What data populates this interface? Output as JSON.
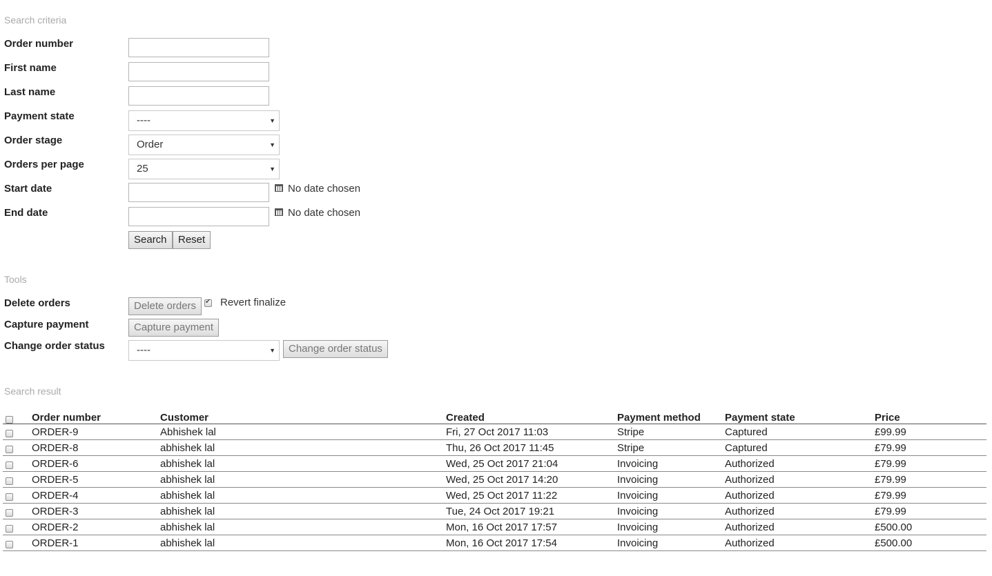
{
  "search": {
    "title": "Search criteria",
    "order_number_label": "Order number",
    "first_name_label": "First name",
    "last_name_label": "Last name",
    "payment_state_label": "Payment state",
    "payment_state_value": "----",
    "order_stage_label": "Order stage",
    "order_stage_value": "Order",
    "orders_per_page_label": "Orders per page",
    "orders_per_page_value": "25",
    "start_date_label": "Start date",
    "start_date_note": "No date chosen",
    "end_date_label": "End date",
    "end_date_note": "No date chosen",
    "search_button": "Search",
    "reset_button": "Reset",
    "dropdown_arrow": "▼"
  },
  "tools": {
    "title": "Tools",
    "delete_label": "Delete orders",
    "delete_button": "Delete orders",
    "revert_label": "Revert finalize",
    "revert_checked": true,
    "check_glyph": "✔",
    "capture_label": "Capture payment",
    "capture_button": "Capture payment",
    "status_label": "Change order status",
    "status_value": "----",
    "status_button": "Change order status"
  },
  "results": {
    "title": "Search result",
    "columns": [
      "Order number",
      "Customer",
      "Created",
      "Payment method",
      "Payment state",
      "Price"
    ],
    "rows": [
      {
        "order": "ORDER-9",
        "customer": "Abhishek lal",
        "created": "Fri, 27 Oct 2017 11:03",
        "method": "Stripe",
        "state": "Captured",
        "price": "£99.99"
      },
      {
        "order": "ORDER-8",
        "customer": "abhishek lal",
        "created": "Thu, 26 Oct 2017 11:45",
        "method": "Stripe",
        "state": "Captured",
        "price": "£79.99"
      },
      {
        "order": "ORDER-6",
        "customer": "abhishek lal",
        "created": "Wed, 25 Oct 2017 21:04",
        "method": "Invoicing",
        "state": "Authorized",
        "price": "£79.99"
      },
      {
        "order": "ORDER-5",
        "customer": "abhishek lal",
        "created": "Wed, 25 Oct 2017 14:20",
        "method": "Invoicing",
        "state": "Authorized",
        "price": "£79.99"
      },
      {
        "order": "ORDER-4",
        "customer": "abhishek lal",
        "created": "Wed, 25 Oct 2017 11:22",
        "method": "Invoicing",
        "state": "Authorized",
        "price": "£79.99"
      },
      {
        "order": "ORDER-3",
        "customer": "abhishek lal",
        "created": "Tue, 24 Oct 2017 19:21",
        "method": "Invoicing",
        "state": "Authorized",
        "price": "£79.99"
      },
      {
        "order": "ORDER-2",
        "customer": "abhishek lal",
        "created": "Mon, 16 Oct 2017 17:57",
        "method": "Invoicing",
        "state": "Authorized",
        "price": "£500.00"
      },
      {
        "order": "ORDER-1",
        "customer": "abhishek lal",
        "created": "Mon, 16 Oct 2017 17:54",
        "method": "Invoicing",
        "state": "Authorized",
        "price": "£500.00"
      }
    ]
  }
}
